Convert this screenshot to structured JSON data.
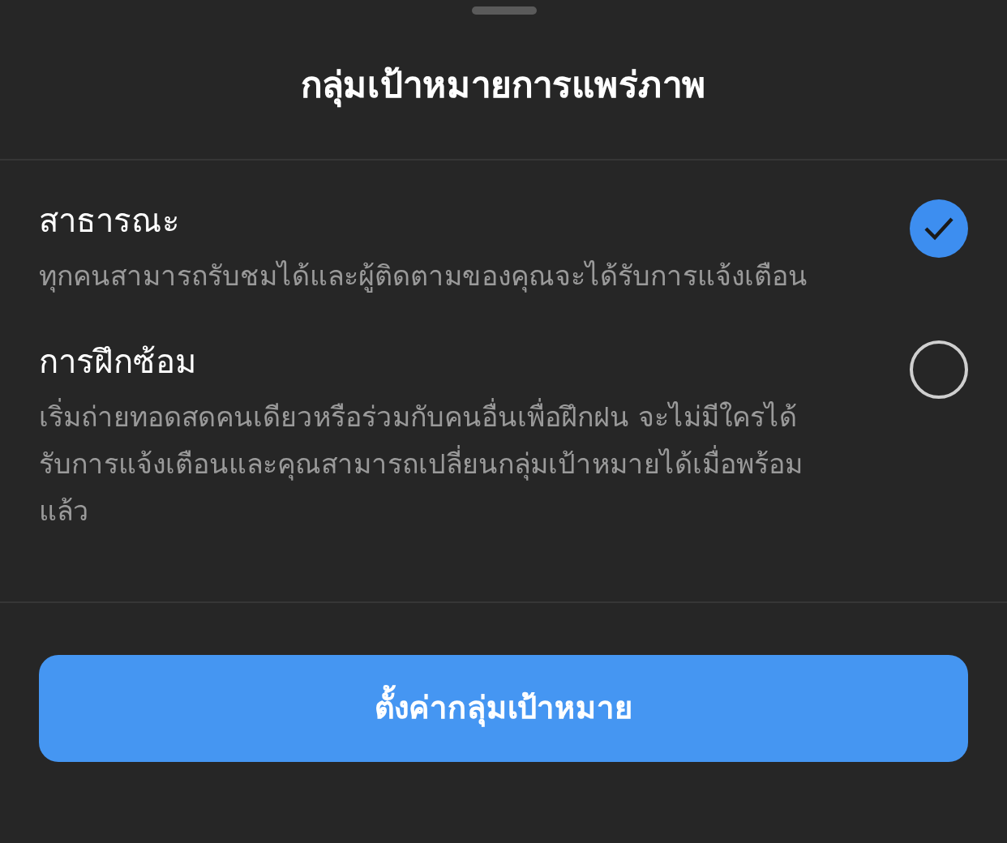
{
  "title": "กลุ่มเป้าหมายการแพร่ภาพ",
  "options": [
    {
      "label": "สาธารณะ",
      "description": "ทุกคนสามารถรับชมได้และผู้ติดตามของคุณจะได้รับการแจ้งเตือน",
      "selected": true
    },
    {
      "label": "การฝึกซ้อม",
      "description": "เริ่มถ่ายทอดสดคนเดียวหรือร่วมกับคนอื่นเพื่อฝึกฝน จะไม่มีใครได้รับการแจ้งเตือนและคุณสามารถเปลี่ยนกลุ่มเป้าหมายได้เมื่อพร้อมแล้ว",
      "selected": false
    }
  ],
  "button": "ตั้งค่ากลุ่มเป้าหมาย"
}
